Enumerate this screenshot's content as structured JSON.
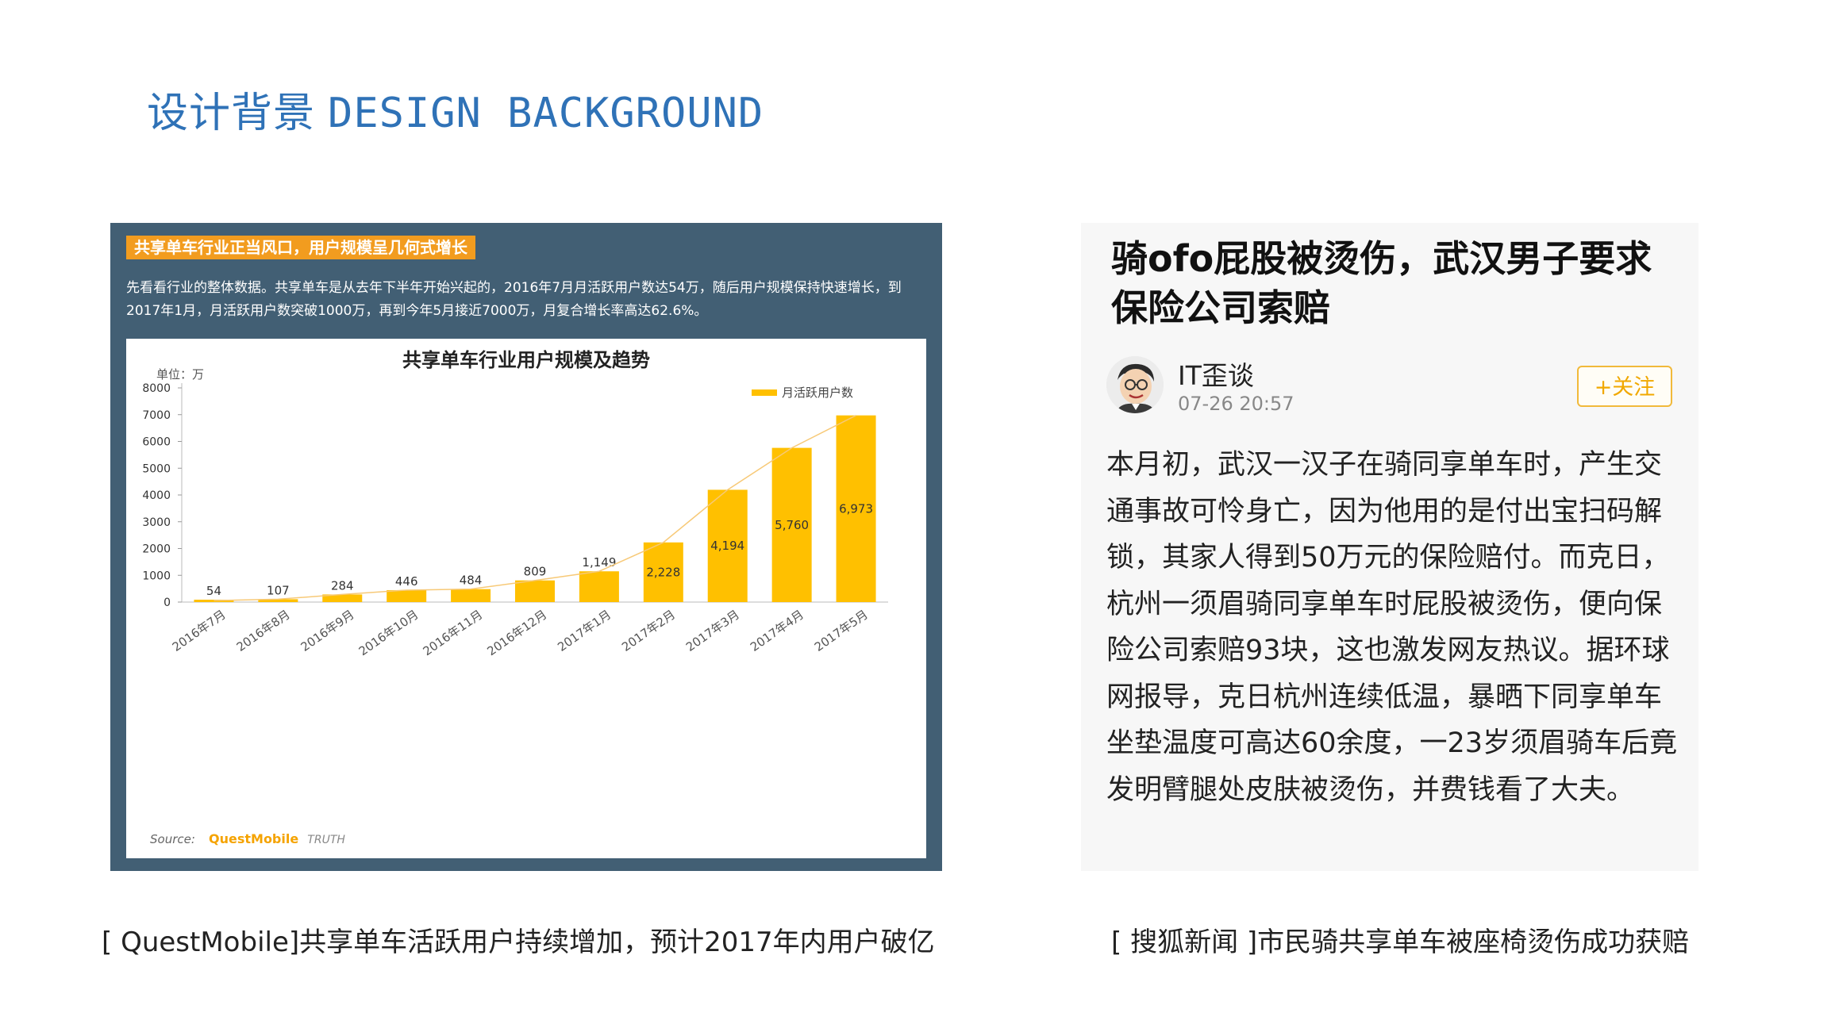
{
  "slide": {
    "title_cn": "设计背景",
    "title_en": "DESIGN BACKGROUND"
  },
  "left_card": {
    "tag": "共享单车行业正当风口，用户规模呈几何式增长",
    "description": "先看看行业的整体数据。共享单车是从去年下半年开始兴起的，2016年7月月活跃用户数达54万，随后用户规模保持快速增长，到2017年1月，月活跃用户数突破1000万，再到今年5月接近7000万，月复合增长率高达62.6%。",
    "source_prefix": "Source:",
    "source_brand": "QuestMobile",
    "source_suffix": "TRUTH"
  },
  "chart_data": {
    "type": "bar",
    "title": "共享单车行业用户规模及趋势",
    "unit_label": "单位：万",
    "legend": "月活跃用户数",
    "legend_position": "top-right",
    "categories": [
      "2016年7月",
      "2016年8月",
      "2016年9月",
      "2016年10月",
      "2016年11月",
      "2016年12月",
      "2017年1月",
      "2017年2月",
      "2017年3月",
      "2017年4月",
      "2017年5月"
    ],
    "series": [
      {
        "name": "月活跃用户数",
        "values": [
          54,
          107,
          284,
          446,
          484,
          809,
          1149,
          2228,
          4194,
          5760,
          6973
        ],
        "labels": [
          "54",
          "107",
          "284",
          "446",
          "484",
          "809",
          "1,149",
          "2,228",
          "4,194",
          "5,760",
          "6,973"
        ]
      }
    ],
    "yticks": [
      "0",
      "1000",
      "2000",
      "3000",
      "4000",
      "5000",
      "6000",
      "7000",
      "8000"
    ],
    "ylim": [
      0,
      8000
    ],
    "trend_line": true,
    "grid": false,
    "bar_color": "#ffc000"
  },
  "right_card": {
    "headline": "骑ofo屁股被烫伤，武汉男子要求保险公司索赔",
    "author": "IT歪谈",
    "time": "07-26 20:57",
    "follow_label": "+关注",
    "body": "本月初，武汉一汉子在骑同享单车时，产生交通事故可怜身亡，因为他用的是付出宝扫码解锁，其家人得到50万元的保险赔付。而克日，杭州一须眉骑同享单车时屁股被烫伤，便向保险公司索赔93块，这也激发网友热议。据环球网报导，克日杭州连续低温，暴晒下同享单车坐垫温度可高达60余度，一23岁须眉骑车后竟发明臂腿处皮肤被烫伤，并费钱看了大夫。"
  },
  "captions": {
    "left": "[ QuestMobile]共享单车活跃用户持续增加，预计2017年内用户破亿",
    "right": "[ 搜狐新闻 ]市民骑共享单车被座椅烫伤成功获赔"
  }
}
